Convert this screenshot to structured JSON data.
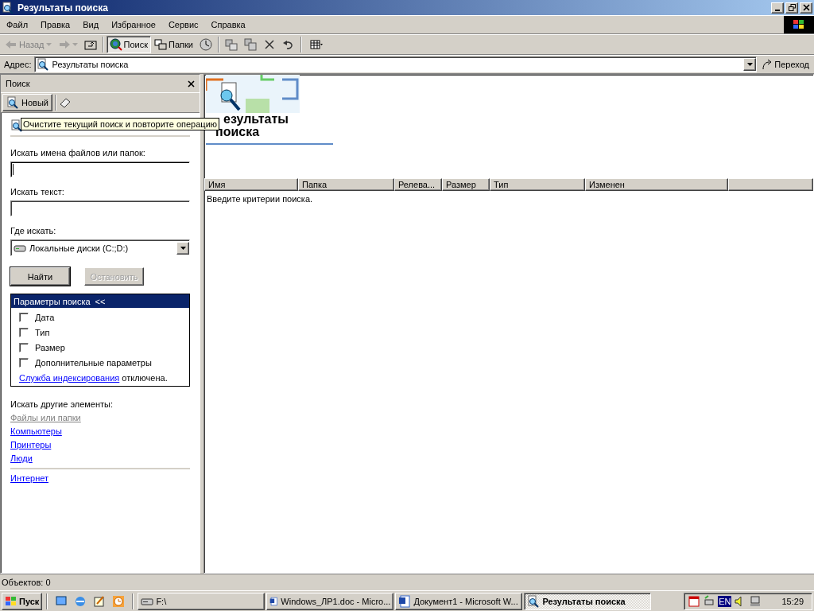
{
  "window": {
    "title": "Результаты поиска"
  },
  "menu": [
    "Файл",
    "Правка",
    "Вид",
    "Избранное",
    "Сервис",
    "Справка"
  ],
  "toolbar": [
    {
      "kind": "back",
      "label": "Назад",
      "disabled": true
    },
    {
      "kind": "forward",
      "disabled": true
    },
    {
      "kind": "up"
    },
    {
      "kind": "search",
      "label": "Поиск",
      "selected": true
    },
    {
      "kind": "folders",
      "label": "Папки",
      "selected": false
    },
    {
      "kind": "history",
      "selected": false
    },
    {
      "kind": "move"
    },
    {
      "kind": "copy"
    },
    {
      "kind": "delete"
    },
    {
      "kind": "undo"
    },
    {
      "kind": "views"
    }
  ],
  "address": {
    "label": "Адрес:",
    "value": "Результаты поиска",
    "go": "Переход"
  },
  "search_pane": {
    "title": "Поиск",
    "new_button": "Новый",
    "tooltip": "Очистите текущий поиск и повторите операцию",
    "fields": [
      {
        "label": "Искать имена файлов или папок:",
        "focused": true
      },
      {
        "label": "Искать текст:",
        "focused": false
      }
    ],
    "location": {
      "label": "Где искать:",
      "value": "Локальные диски (C:;D:)"
    },
    "buttons": [
      {
        "label": "Найти",
        "disabled": false
      },
      {
        "label": "Остановить",
        "disabled": true
      }
    ],
    "options": {
      "title": "Параметры поиска",
      "toggle": "<<",
      "expanded": true,
      "items": [
        {
          "label": "Дата",
          "checked": false
        },
        {
          "label": "Тип",
          "checked": false
        },
        {
          "label": "Размер",
          "checked": false
        },
        {
          "label": "Дополнительные параметры",
          "checked": false
        }
      ],
      "indexing_link": "Служба индексирования",
      "indexing_text": "отключена."
    },
    "other": {
      "label": "Искать другие элементы:",
      "links": [
        {
          "label": "Файлы или папки",
          "disabled": true
        },
        {
          "label": "Компьютеры",
          "disabled": false
        },
        {
          "label": "Принтеры",
          "disabled": false
        },
        {
          "label": "Люди",
          "disabled": false
        }
      ],
      "internet": "Интернет"
    }
  },
  "results": {
    "heading": [
      "езультаты",
      "поиска"
    ],
    "columns": [
      "Имя",
      "Папка",
      "Релева...",
      "Размер",
      "Тип",
      "Изменен"
    ],
    "message": "Введите критерии поиска."
  },
  "status_bar": "Объектов: 0",
  "taskbar": {
    "start": "Пуск",
    "tasks": [
      {
        "kind": "drive",
        "label": "F:\\",
        "selected": false
      },
      {
        "kind": "word",
        "label": "Windows_ЛР1.doc - Micro...",
        "selected": false
      },
      {
        "kind": "word",
        "label": "Документ1 - Microsoft W...",
        "selected": false
      },
      {
        "kind": "search",
        "label": "Результаты поиска",
        "selected": true
      }
    ],
    "language": "EN",
    "clock": "15:29"
  }
}
